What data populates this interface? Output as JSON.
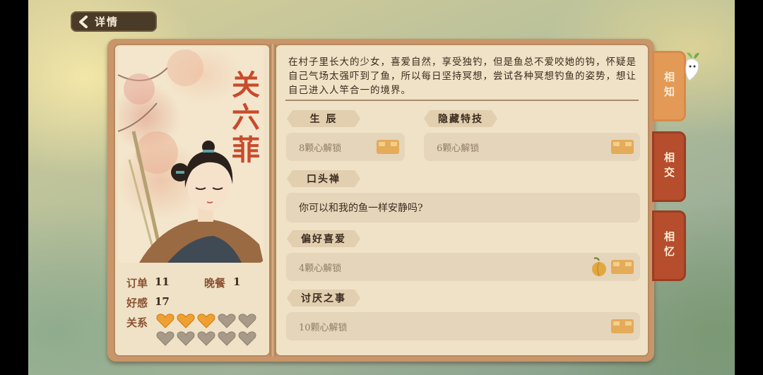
{
  "header": {
    "back_label": "详情"
  },
  "character": {
    "name": "关六菲",
    "description": "在村子里长大的少女，喜爱自然，享受独钓，但是鱼总不爱咬她的钩，怀疑是自己气场太强吓到了鱼，所以每日坚持冥想，尝试各种冥想钓鱼的姿势，想让自己进入人竿合一的境界。"
  },
  "stats": {
    "orders_label": "订单",
    "orders_value": "11",
    "dinner_label": "晚餐",
    "dinner_value": "1",
    "affection_label": "好感",
    "affection_value": "17",
    "relation_label": "关系",
    "relation_level": 3,
    "relation_max": 10
  },
  "sections": {
    "birthday": {
      "title": "生 辰",
      "value": "8颗心解锁"
    },
    "hidden_skill": {
      "title": "隐藏特技",
      "value": "6颗心解锁"
    },
    "catchphrase": {
      "title": "口头禅",
      "value": "你可以和我的鱼一样安静吗?"
    },
    "likes": {
      "title": "偏好喜爱",
      "value": "4颗心解锁"
    },
    "dislikes": {
      "title": "讨厌之事",
      "value": "10颗心解锁"
    }
  },
  "side_tabs": [
    {
      "label": "相知",
      "active": true
    },
    {
      "label": "相交",
      "active": false
    },
    {
      "label": "相忆",
      "active": false
    }
  ],
  "colors": {
    "heart_filled": "#f0a030",
    "heart_empty": "#a89a88",
    "name_red": "#c84b2c",
    "tab_active": "#e39a56",
    "tab_inactive": "#b64d2c"
  }
}
